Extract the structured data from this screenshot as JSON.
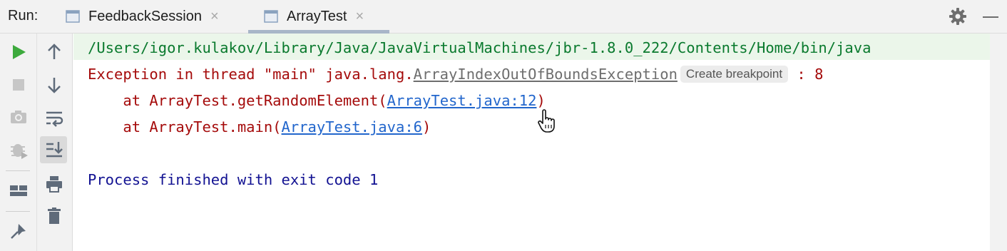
{
  "run_label": "Run:",
  "tabs": [
    {
      "label": "FeedbackSession",
      "active": false
    },
    {
      "label": "ArrayTest",
      "active": true
    }
  ],
  "console": {
    "path_line": "/Users/igor.kulakov/Library/Java/JavaVirtualMachines/jbr-1.8.0_222/Contents/Home/bin/java",
    "exception_prefix": "Exception in thread \"main\" java.lang.",
    "exception_class": "ArrayIndexOutOfBoundsException",
    "create_breakpoint": "Create breakpoint",
    "exception_suffix": " : 8",
    "stack": [
      {
        "prefix": "    at ArrayTest.getRandomElement(",
        "link": "ArrayTest.java:12",
        "suffix": ")"
      },
      {
        "prefix": "    at ArrayTest.main(",
        "link": "ArrayTest.java:6",
        "suffix": ")"
      }
    ],
    "finished": "Process finished with exit code 1"
  },
  "icons": {
    "left_toolbar": [
      "run-icon",
      "stop-icon",
      "camera-icon",
      "debug-icon",
      "layout-icon",
      "pin-icon"
    ],
    "right_toolbar": [
      "arrow-up-icon",
      "arrow-down-icon",
      "soft-wrap-icon",
      "scroll-to-end-icon",
      "print-icon",
      "trash-icon"
    ]
  },
  "colors": {
    "error_text": "#a50b0b",
    "path_text": "#0a7a2e",
    "link": "#2266cc",
    "finished_text": "#121292",
    "run_green": "#3daa3d"
  }
}
